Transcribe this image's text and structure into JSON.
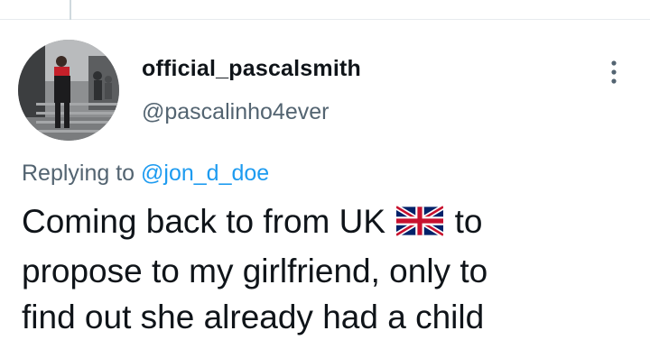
{
  "tweet": {
    "display_name": "official_pascalsmith",
    "handle": "@pascalinho4ever",
    "replying_prefix": "Replying to",
    "replying_to": "@jon_d_doe",
    "text_line1_before_flag": "Coming back to from UK",
    "flag_icon": "uk-flag-icon",
    "text_line1_after_flag": "to",
    "text_line2": "propose to my girlfriend, only to",
    "text_line3": "find out she already had a child"
  },
  "colors": {
    "text_primary": "#0f1419",
    "text_secondary": "#536471",
    "link": "#1d9bf0",
    "divider": "#e7ebee"
  }
}
